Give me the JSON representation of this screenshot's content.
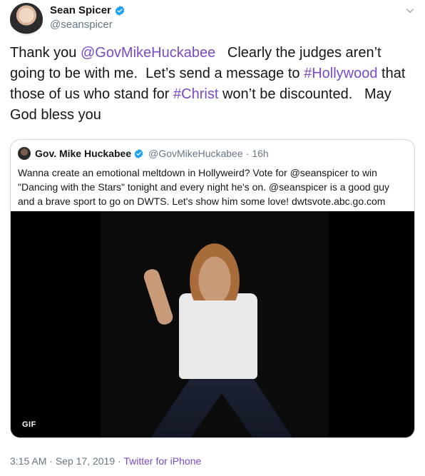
{
  "author": {
    "display_name": "Sean Spicer",
    "handle": "@seanspicer"
  },
  "tweet": {
    "segments": [
      {
        "type": "text",
        "value": "Thank you "
      },
      {
        "type": "mention",
        "value": "@GovMikeHuckabee"
      },
      {
        "type": "text",
        "value": "   Clearly the judges aren’t going to be with me.  Let’s send a message to "
      },
      {
        "type": "hashtag",
        "value": "#Hollywood"
      },
      {
        "type": "text",
        "value": " that those of us who stand for "
      },
      {
        "type": "hashtag",
        "value": "#Christ"
      },
      {
        "type": "text",
        "value": " won’t be discounted.   May God bless you"
      }
    ]
  },
  "quoted": {
    "display_name": "Gov. Mike Huckabee",
    "handle": "@GovMikeHuckabee",
    "separator": "·",
    "time": "16h",
    "text": "Wanna create an emotional meltdown in Hollyweird?  Vote for @seanspicer to win \"Dancing with the Stars\" tonight and every night he's on.  @seanspicer is a good guy and a brave sport to go on DWTS.  Let's show him some love! dwtsvote.abc.go.com",
    "media_badge": "GIF"
  },
  "footer": {
    "time": "3:15 AM",
    "date": "Sep 17, 2019",
    "separator": "·",
    "source": "Twitter for iPhone"
  },
  "colors": {
    "link": "#794bc4",
    "verified": "#1da1f2",
    "muted": "#657786",
    "border": "#ccd6dd"
  },
  "icons": [
    "verified-badge-icon",
    "chevron-down-icon"
  ]
}
